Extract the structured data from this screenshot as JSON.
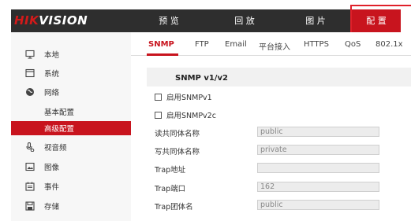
{
  "brand": {
    "logo_red": "HIK",
    "logo_white": "VISION"
  },
  "topnav": [
    {
      "label": "预 览"
    },
    {
      "label": "回 放"
    },
    {
      "label": "图 片"
    },
    {
      "label": "配 置"
    }
  ],
  "sidebar": {
    "items": [
      {
        "label": "本地",
        "icon": "monitor-icon"
      },
      {
        "label": "系统",
        "icon": "system-icon"
      },
      {
        "label": "网络",
        "icon": "globe-icon"
      },
      {
        "label": "基本配置"
      },
      {
        "label": "高级配置"
      },
      {
        "label": "视音频",
        "icon": "video-audio-icon"
      },
      {
        "label": "图像",
        "icon": "image-icon"
      },
      {
        "label": "事件",
        "icon": "calendar-icon"
      },
      {
        "label": "存储",
        "icon": "storage-icon"
      }
    ]
  },
  "tabs": [
    {
      "label": "SNMP"
    },
    {
      "label": "FTP"
    },
    {
      "label": "Email"
    },
    {
      "label": "平台接入"
    },
    {
      "label": "HTTPS"
    },
    {
      "label": "QoS"
    },
    {
      "label": "802.1x"
    }
  ],
  "form": {
    "section_title": "SNMP v1/v2",
    "enable_v1": "启用SNMPv1",
    "enable_v2c": "启用SNMPv2c",
    "read_community_label": "读共同体名称",
    "read_community_value": "public",
    "write_community_label": "写共同体名称",
    "write_community_value": "private",
    "trap_address_label": "Trap地址",
    "trap_address_value": "",
    "trap_port_label": "Trap端口",
    "trap_port_value": "162",
    "trap_community_label": "Trap团体名",
    "trap_community_value": "public"
  },
  "colors": {
    "accent": "#c8141e",
    "topbar": "#2e2e2e",
    "highlight": "#e0202a"
  }
}
